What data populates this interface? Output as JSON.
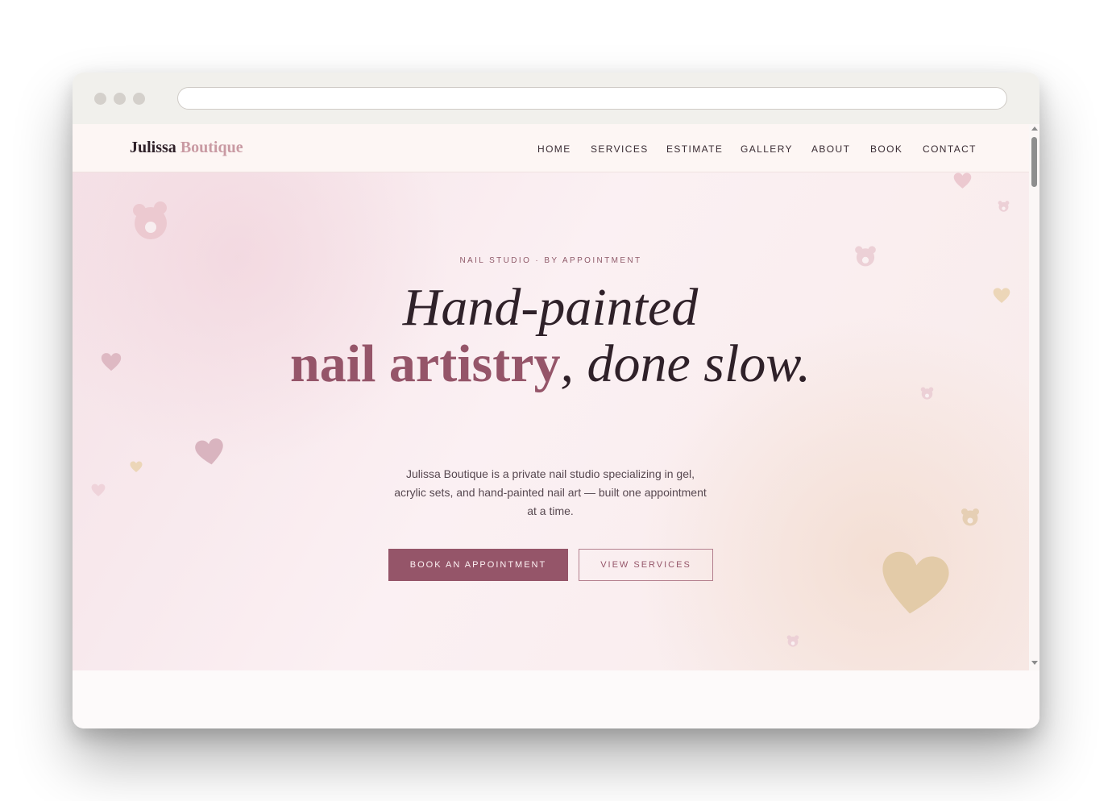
{
  "brand": {
    "name_part1": "Julissa",
    "name_part2": "Boutique"
  },
  "nav": {
    "items": [
      {
        "label": "HOME"
      },
      {
        "label": "SERVICES"
      },
      {
        "label": "ESTIMATE"
      },
      {
        "label": "GALLERY"
      },
      {
        "label": "ABOUT"
      },
      {
        "label": "BOOK"
      },
      {
        "label": "CONTACT"
      }
    ]
  },
  "hero": {
    "kicker": "NAIL STUDIO · BY APPOINTMENT",
    "headline_line1": "Hand-painted",
    "headline_accent": "nail artistry",
    "headline_rest": ", done slow.",
    "description": "Julissa Boutique is a private nail studio specializing in gel, acrylic sets, and hand-painted nail art — built one appointment at a time.",
    "primary_button": "BOOK AN APPOINTMENT",
    "secondary_button": "VIEW SERVICES"
  },
  "colors": {
    "accent": "#955569",
    "logo_accent": "#c99aa3",
    "text_dark": "#2f2129",
    "heart_pink": "#d9b4bf",
    "heart_gold": "#e3cba8"
  },
  "decorations": [
    "heart-icon",
    "bear-icon"
  ]
}
